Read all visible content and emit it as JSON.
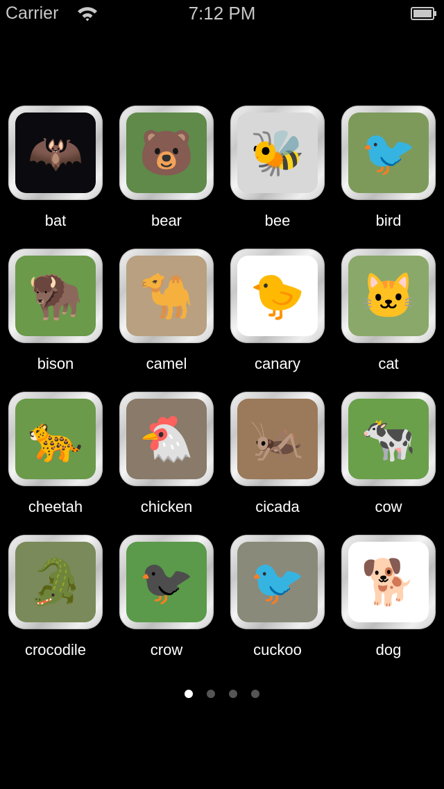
{
  "status_bar": {
    "carrier": "Carrier",
    "time": "7:12 PM",
    "wifi_icon": "wifi-icon",
    "battery_icon": "battery-icon"
  },
  "animals": [
    {
      "label": "bat",
      "glyph": "🦇",
      "bg": "#0b0b0f"
    },
    {
      "label": "bear",
      "glyph": "🐻",
      "bg": "#5f8a4a"
    },
    {
      "label": "bee",
      "glyph": "🐝",
      "bg": "#d8d8d8"
    },
    {
      "label": "bird",
      "glyph": "🐦",
      "bg": "#7d9a5a"
    },
    {
      "label": "bison",
      "glyph": "🦬",
      "bg": "#6a9a4a"
    },
    {
      "label": "camel",
      "glyph": "🐪",
      "bg": "#b8a080"
    },
    {
      "label": "canary",
      "glyph": "🐤",
      "bg": "#ffffff"
    },
    {
      "label": "cat",
      "glyph": "🐱",
      "bg": "#8aa86a"
    },
    {
      "label": "cheetah",
      "glyph": "🐆",
      "bg": "#6a9a4a"
    },
    {
      "label": "chicken",
      "glyph": "🐔",
      "bg": "#8a7a6a"
    },
    {
      "label": "cicada",
      "glyph": "🦗",
      "bg": "#9a7a5a"
    },
    {
      "label": "cow",
      "glyph": "🐄",
      "bg": "#6aa04a"
    },
    {
      "label": "crocodile",
      "glyph": "🐊",
      "bg": "#7a8a5a"
    },
    {
      "label": "crow",
      "glyph": "🐦‍⬛",
      "bg": "#5a9a4a"
    },
    {
      "label": "cuckoo",
      "glyph": "🐦",
      "bg": "#8a8a7a"
    },
    {
      "label": "dog",
      "glyph": "🐕",
      "bg": "#ffffff"
    }
  ],
  "page_indicator": {
    "pages": 4,
    "current": 1
  }
}
